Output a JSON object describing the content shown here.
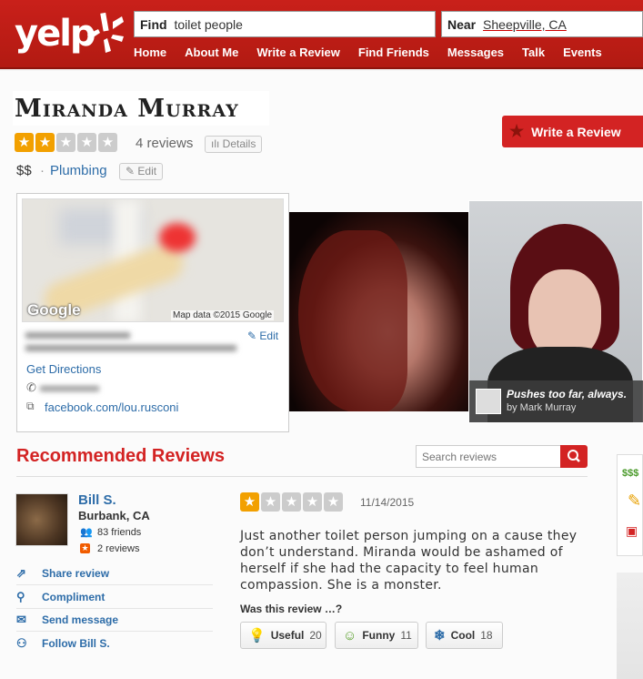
{
  "header": {
    "logo_text": "yelp",
    "find_label": "Find",
    "find_value": "toilet people",
    "near_label": "Near",
    "near_value": "Sheepville, CA",
    "nav": [
      "Home",
      "About Me",
      "Write a Review",
      "Find Friends",
      "Messages",
      "Talk",
      "Events"
    ]
  },
  "business": {
    "name": "Miranda Murray",
    "rating": 2,
    "review_count": "4 reviews",
    "details_label": "Details",
    "price": "$$",
    "category": "Plumbing",
    "edit_label": "Edit",
    "write_review_label": "Write a Review"
  },
  "map": {
    "google_label": "Google",
    "credit": "Map data ©2015 Google",
    "edit_label": "Edit",
    "get_directions": "Get Directions",
    "website": "facebook.com/lou.rusconi"
  },
  "photo_caption": {
    "text": "Pushes too far, always.",
    "by": "by Mark Murray"
  },
  "reviews": {
    "title": "Recommended Reviews",
    "search_placeholder": "Search reviews",
    "items": [
      {
        "name": "Bill S.",
        "location": "Burbank, CA",
        "friends": "83 friends",
        "reviews": "2 reviews",
        "rating": 1,
        "date": "11/14/2015",
        "text": "Just another toilet person jumping on a cause they don’t understand. Miranda would be ashamed of herself if she had the capacity to feel human compassion. She is a monster.",
        "actions": [
          "Share review",
          "Compliment",
          "Send message",
          "Follow Bill S."
        ],
        "helpful_prompt": "Was this review …?",
        "votes": {
          "useful_label": "Useful",
          "useful": "20",
          "funny_label": "Funny",
          "funny": "11",
          "cool_label": "Cool",
          "cool": "18"
        }
      }
    ]
  },
  "sidebar": {
    "price": "$$$"
  },
  "colors": {
    "brand": "#d32323",
    "link": "#2d6ca8",
    "star": "#f2a000"
  }
}
